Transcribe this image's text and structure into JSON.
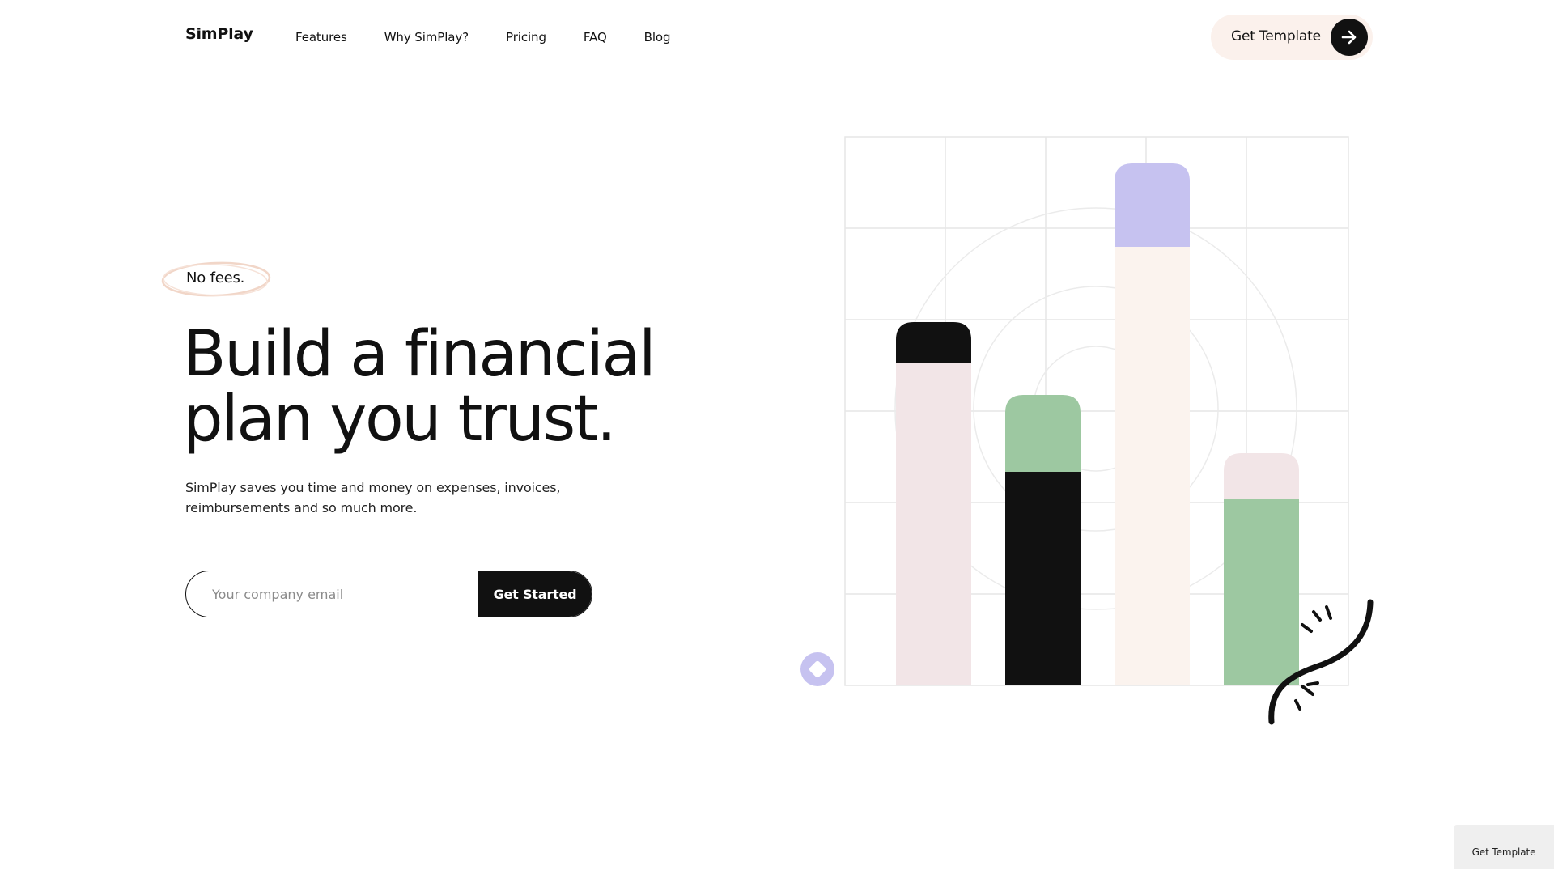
{
  "brand": {
    "logo": "SimPlay"
  },
  "nav": {
    "items": [
      "Features",
      "Why SimPlay?",
      "Pricing",
      "FAQ",
      "Blog"
    ],
    "cta_label": "Get Template",
    "cta_icon": "arrow-right-icon"
  },
  "hero": {
    "badge": "No fees.",
    "headline_line1": "Build a financial",
    "headline_line2": "plan you trust.",
    "subtext_line1": "SimPlay saves you time and money on expenses, invoices,",
    "subtext_line2": "reimbursements and so much more.",
    "email_placeholder": "Your company email",
    "submit_label": "Get Started"
  },
  "illustration": {
    "bars": [
      {
        "top_color": "#111111",
        "body_color": "#f2e5e7"
      },
      {
        "top_color": "#9dc8a1",
        "body_color": "#111111"
      },
      {
        "top_color": "#c6c2f0",
        "body_color": "#fbf3ee"
      },
      {
        "top_color": "#f2e5e7",
        "body_color": "#9dc8a1"
      }
    ],
    "accent_dot_color": "#c6c2f0",
    "decoration_icon": "squiggle-arrow-icon"
  },
  "floating_button": {
    "label": "Get Template"
  },
  "colors": {
    "text": "#111111",
    "cta_bg": "#fbf1ec",
    "badge_ring": "#f1d6c8",
    "grid_line": "#e6e6e6"
  }
}
